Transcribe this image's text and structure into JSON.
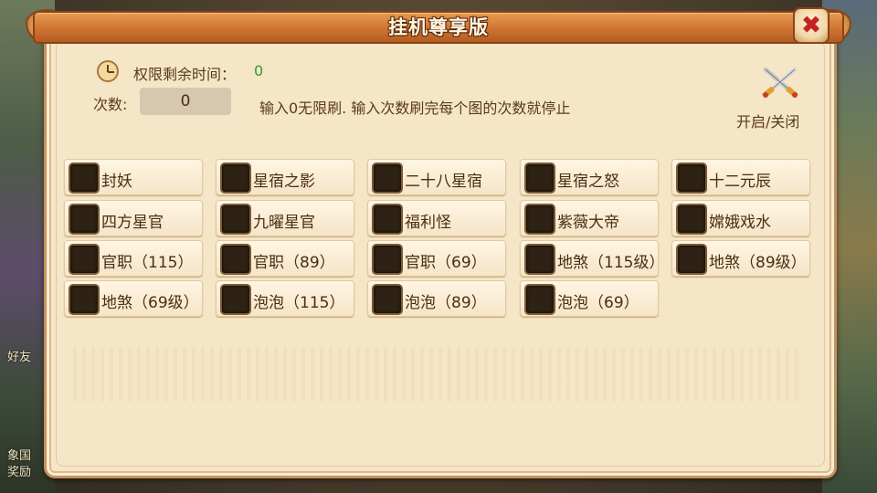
{
  "title": "挂机尊享版",
  "close_icon": "close-x-icon",
  "time": {
    "label": "权限剩余时间：",
    "value": "0"
  },
  "count": {
    "label": "次数:",
    "value": "0"
  },
  "hint": "输入0无限刷. 输入次数刷完每个图的次数就停止",
  "toggle": {
    "icon": "crossed-swords-icon",
    "label": "开启/关闭"
  },
  "options": [
    "封妖",
    "星宿之影",
    "二十八星宿",
    "星宿之怒",
    "十二元辰",
    "四方星官",
    "九曜星官",
    "福利怪",
    "紫薇大帝",
    "嫦娥戏水",
    "官职（115）",
    "官职（89）",
    "官职（69）",
    "地煞（115级）",
    "地煞（89级）",
    "地煞（69级）",
    "泡泡（115）",
    "泡泡（89）",
    "泡泡（69）"
  ],
  "background": {
    "left_text_1": "好友",
    "left_text_2": "象国",
    "left_text_3": "奖励"
  },
  "colors": {
    "title_bar": "#cf7433",
    "panel": "#f6e6c8",
    "time_value": "#2f9a2f",
    "close": "#c82020"
  }
}
